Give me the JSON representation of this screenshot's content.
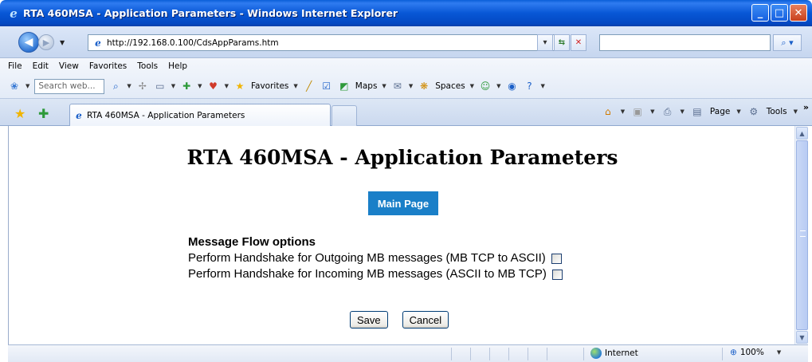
{
  "window": {
    "title": "RTA 460MSA - Application Parameters - Windows Internet Explorer",
    "minimize": "_",
    "maximize": "□",
    "close": "✕"
  },
  "address": {
    "url": "http://192.168.0.100/CdsAppParams.htm",
    "search_value": ""
  },
  "menu": [
    "File",
    "Edit",
    "View",
    "Favorites",
    "Tools",
    "Help"
  ],
  "toolbar": {
    "search_placeholder": "Search web...",
    "favorites_label": "Favorites",
    "maps_label": "Maps",
    "spaces_label": "Spaces"
  },
  "tab": {
    "title": "RTA 460MSA - Application Parameters"
  },
  "commandbar": {
    "page_label": "Page",
    "tools_label": "Tools"
  },
  "page": {
    "heading": "RTA 460MSA - Application Parameters",
    "main_page_button": "Main Page",
    "options_heading": "Message Flow options",
    "options": [
      {
        "label": "Perform Handshake for Outgoing MB messages (MB TCP to ASCII)",
        "checked": false
      },
      {
        "label": "Perform Handshake for Incoming MB messages (ASCII to MB TCP)",
        "checked": false
      }
    ],
    "save_button": "Save",
    "cancel_button": "Cancel"
  },
  "status": {
    "zone": "Internet",
    "zoom": "100%"
  }
}
